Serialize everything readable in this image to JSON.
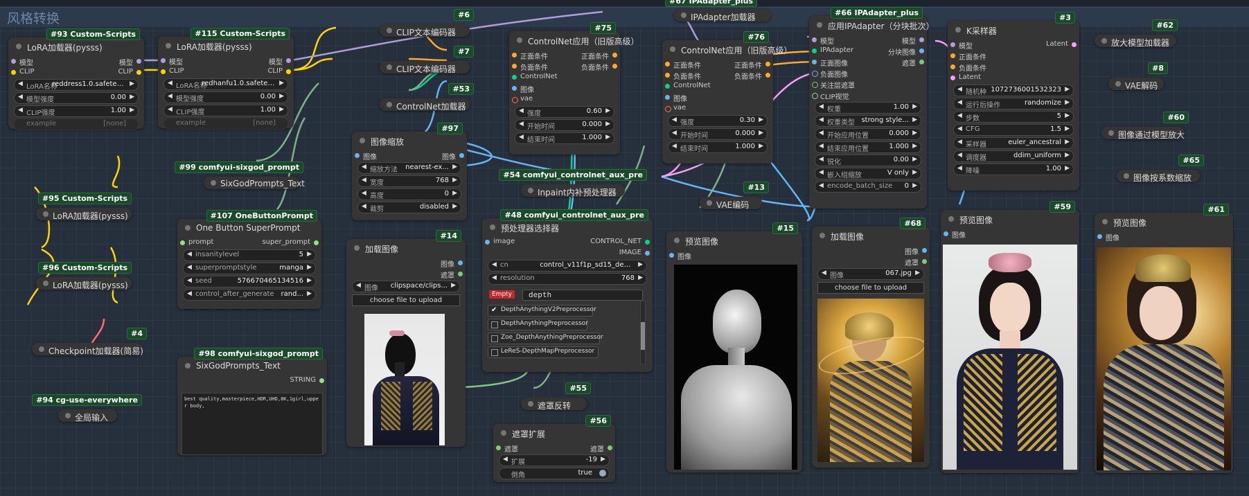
{
  "group_title": "风格转换",
  "colors": {
    "model": "#b39ddb",
    "clip": "#ffd500",
    "cond": "#ffa931",
    "image": "#64b5f6",
    "latent": "#ff9cf9",
    "vae": "#ff6e6e",
    "cnet": "#00d78d",
    "mask": "#81c784",
    "link_green": "#7fb28a"
  },
  "nodes": {
    "n93": {
      "badge": "#93 Custom-Scripts",
      "title": "LoRA加载器(pysss)",
      "in_model": "模型",
      "in_clip": "CLIP",
      "out_model": "模型",
      "out_clip": "CLIP",
      "widgets": [
        {
          "k": "LoRA名称",
          "v": "reddress1.0.safeten..."
        },
        {
          "k": "模型强度",
          "v": "0.00"
        },
        {
          "k": "CLIP强度",
          "v": "1.00"
        }
      ],
      "example_k": "example",
      "example_v": "[none]"
    },
    "n115": {
      "badge": "#115 Custom-Scripts",
      "title": "LoRA加载器(pysss)",
      "in_model": "模型",
      "in_clip": "CLIP",
      "out_model": "模型",
      "out_clip": "CLIP",
      "widgets": [
        {
          "k": "LoRA名称",
          "v": "redhanfu1.0.safeten..."
        },
        {
          "k": "模型强度",
          "v": "0.00"
        },
        {
          "k": "CLIP强度",
          "v": "1.00"
        }
      ],
      "example_k": "example",
      "example_v": "[none]"
    },
    "n6": {
      "badge": "#6",
      "title": "CLIP文本编码器"
    },
    "n7": {
      "badge": "#7",
      "title": "CLIP文本编码器"
    },
    "n53": {
      "badge": "#53",
      "title": "ControlNet加载器"
    },
    "n75": {
      "badge": "#75",
      "title": "ControlNet应用（旧版高级）",
      "in": [
        "正面条件",
        "负面条件",
        "ControlNet",
        "图像",
        "vae"
      ],
      "out": [
        "正面条件",
        "负面条件"
      ],
      "widgets": [
        {
          "k": "强度",
          "v": "0.60"
        },
        {
          "k": "开始时间",
          "v": "0.000"
        },
        {
          "k": "结束时间",
          "v": "1.000"
        }
      ]
    },
    "n67": {
      "badge": "#67 IPAdapter_plus",
      "title": "IPAdapter加载器"
    },
    "n76": {
      "badge": "#76",
      "title": "ControlNet应用（旧版高级）",
      "in": [
        "正面条件",
        "负面条件",
        "ControlNet",
        "图像",
        "vae"
      ],
      "out": [
        "正面条件",
        "负面条件"
      ],
      "widgets": [
        {
          "k": "强度",
          "v": "0.30"
        },
        {
          "k": "开始时间",
          "v": "0.000"
        },
        {
          "k": "结束时间",
          "v": "1.000"
        }
      ]
    },
    "n66": {
      "badge": "#66 IPAdapter_plus",
      "title": "应用IPAdapter（分块批次）",
      "in": [
        "模型",
        "IPAdapter",
        "正面图像",
        "负面图像",
        "关注层遮罩",
        "CLIP视觉"
      ],
      "out": [
        "模型",
        "分块图像",
        "遮罩"
      ],
      "widgets": [
        {
          "k": "权重",
          "v": "1.00"
        },
        {
          "k": "权重类型",
          "v": "strong style..."
        },
        {
          "k": "开始应用位置",
          "v": "0.000"
        },
        {
          "k": "结束应用位置",
          "v": "1.000"
        },
        {
          "k": "锐化",
          "v": "0.00"
        },
        {
          "k": "嵌入组缩放",
          "v": "V only"
        },
        {
          "k": "encode_batch_size",
          "v": "0"
        }
      ]
    },
    "n3": {
      "badge": "#3",
      "title": "K采样器",
      "in": [
        "模型",
        "正面条件",
        "负面条件",
        "Latent"
      ],
      "out": [
        "Latent"
      ],
      "widgets": [
        {
          "k": "随机种",
          "v": "1072736001532323"
        },
        {
          "k": "运行后操作",
          "v": "randomize"
        },
        {
          "k": "步数",
          "v": "5"
        },
        {
          "k": "CFG",
          "v": "1.5"
        },
        {
          "k": "采样器",
          "v": "euler_ancestral"
        },
        {
          "k": "调度器",
          "v": "ddim_uniform"
        },
        {
          "k": "降噪",
          "v": "1.00"
        }
      ]
    },
    "n62": {
      "badge": "#62",
      "title": "放大模型加载器"
    },
    "n8": {
      "badge": "#8",
      "title": "VAE解码"
    },
    "n60": {
      "badge": "#60",
      "title": "图像通过模型放大"
    },
    "n65": {
      "badge": "#65",
      "title": "图像按系数缩放"
    },
    "n97": {
      "badge": "#97",
      "title": "图像缩放",
      "in": "图像",
      "out": "图像",
      "widgets": [
        {
          "k": "缩放方法",
          "v": "nearest-ex..."
        },
        {
          "k": "宽度",
          "v": "768"
        },
        {
          "k": "高度",
          "v": "0"
        },
        {
          "k": "裁剪",
          "v": "disabled"
        }
      ]
    },
    "n99": {
      "badge": "#99 comfyui-sixgod_prompt",
      "title": "SixGodPrompts_Text"
    },
    "n54": {
      "badge": "#54 comfyui_controlnet_aux_pre",
      "title": "Inpaint内补预处理器"
    },
    "n13": {
      "badge": "#13",
      "title": "VAE编码"
    },
    "n95": {
      "badge": "#95 Custom-Scripts",
      "title": "LoRA加载器(pysss)"
    },
    "n96": {
      "badge": "#96 Custom-Scripts",
      "title": "LoRA加载器(pysss)"
    },
    "n107": {
      "badge": "#107 OneButtonPrompt",
      "title": "One Button SuperPrompt",
      "in": "prompt",
      "out": "super_prompt",
      "widgets": [
        {
          "k": "insanitylevel",
          "v": "5"
        },
        {
          "k": "superpromptstyle",
          "v": "manga"
        },
        {
          "k": "seed",
          "v": "576670465134516"
        },
        {
          "k": "control_after_generate",
          "v": "rand..."
        }
      ]
    },
    "n14": {
      "badge": "#14",
      "title": "加载图像",
      "out": [
        "图像",
        "遮罩"
      ],
      "widget": {
        "k": "图像",
        "v": "clipspace/clips..."
      },
      "upload": "choose file to upload"
    },
    "n48": {
      "badge": "#48 comfyui_controlnet_aux_pre",
      "title": "预处理器选择器",
      "in": "image",
      "out": [
        "CONTROL_NET",
        "IMAGE"
      ],
      "widgets": [
        {
          "k": "cn",
          "v": "control_v11f1p_sd15_depth.pth"
        },
        {
          "k": "resolution",
          "v": "768"
        }
      ],
      "empty_label": "Empty",
      "search": "depth",
      "options": [
        "DepthAnythingV2Preprocessor",
        "DepthAnythingPreprocessor",
        "Zoe_DepthAnythingPreprocessor",
        "LeReS-DepthMapPreprocessor"
      ]
    },
    "n15": {
      "badge": "#15",
      "title": "预览图像",
      "in": "图像"
    },
    "n68": {
      "badge": "#68",
      "title": "加载图像",
      "out": [
        "图像",
        "遮罩"
      ],
      "widget": {
        "k": "图像",
        "v": "067.jpg"
      },
      "upload": "choose file to upload"
    },
    "n59": {
      "badge": "#59",
      "title": "预览图像",
      "in": "图像"
    },
    "n61": {
      "badge": "#61",
      "title": "预览图像",
      "in": "图像"
    },
    "n4": {
      "badge": "#4",
      "title": "Checkpoint加载器(简易)"
    },
    "n98": {
      "badge": "#98 comfyui-sixgod_prompt",
      "title": "SixGodPrompts_Text",
      "out": "STRING",
      "text": "best quality,masterpiece,HDR,UHD,8K,1girl,upper body,"
    },
    "n94": {
      "badge": "#94 cg-use-everywhere",
      "title": "全局输入"
    },
    "n55": {
      "badge": "#55",
      "title": "遮罩反转"
    },
    "n56": {
      "badge": "#56",
      "title": "遮罩扩展",
      "in": "遮罩",
      "out": "遮罩",
      "widgets": [
        {
          "k": "扩展",
          "v": "-19"
        },
        {
          "k": "倒角",
          "v": "true"
        }
      ]
    }
  }
}
